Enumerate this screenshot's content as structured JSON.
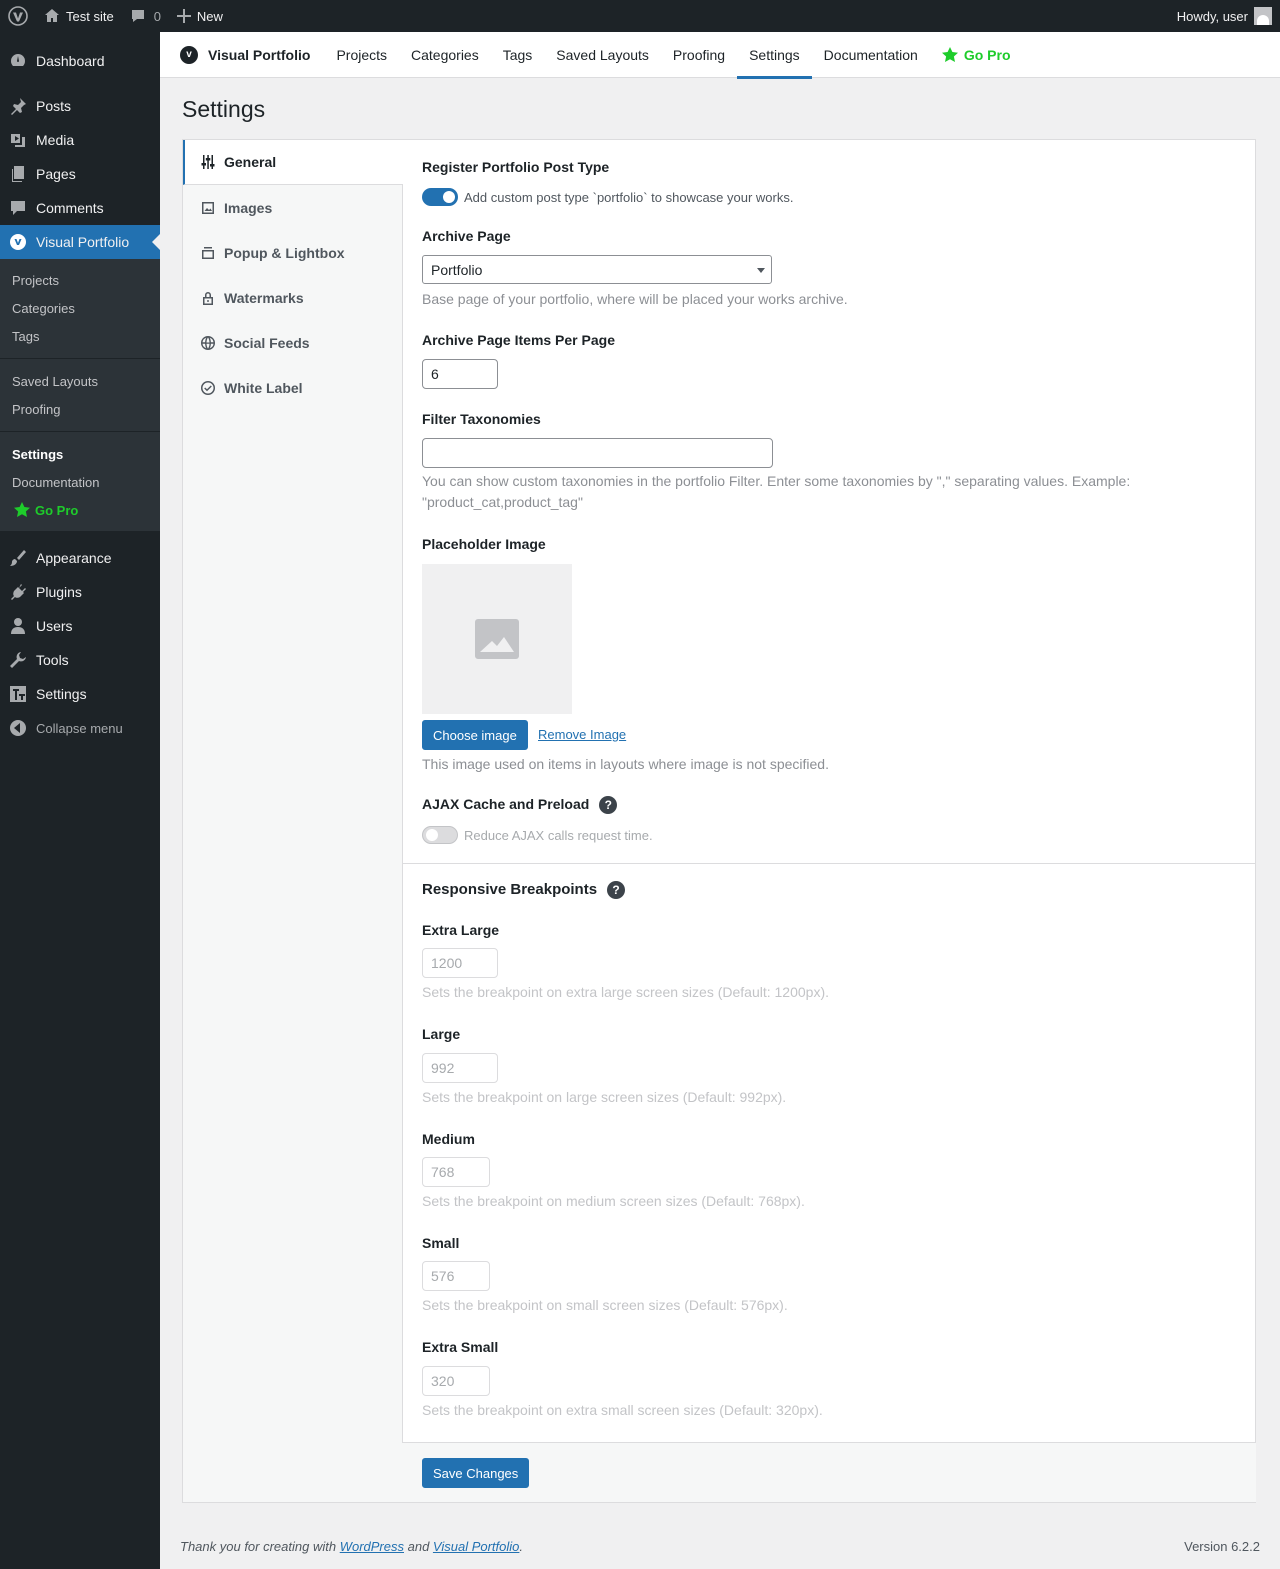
{
  "adminbar": {
    "site_name": "Test site",
    "comments_count": "0",
    "new_label": "New",
    "howdy": "Howdy, user"
  },
  "sidebar": {
    "items": [
      {
        "label": "Dashboard",
        "icon": "dashboard-icon"
      },
      {
        "label": "Posts",
        "icon": "pin-icon"
      },
      {
        "label": "Media",
        "icon": "media-icon"
      },
      {
        "label": "Pages",
        "icon": "pages-icon"
      },
      {
        "label": "Comments",
        "icon": "comment-icon"
      },
      {
        "label": "Visual Portfolio",
        "icon": "visual-portfolio-icon"
      }
    ],
    "submenu": [
      "Projects",
      "Categories",
      "Tags",
      "Saved Layouts",
      "Proofing",
      "Settings",
      "Documentation",
      "Go Pro"
    ],
    "items_after": [
      {
        "label": "Appearance",
        "icon": "brush-icon"
      },
      {
        "label": "Plugins",
        "icon": "plugin-icon"
      },
      {
        "label": "Users",
        "icon": "users-icon"
      },
      {
        "label": "Tools",
        "icon": "wrench-icon"
      },
      {
        "label": "Settings",
        "icon": "settings-icon"
      }
    ],
    "collapse": "Collapse menu"
  },
  "topnav": {
    "brand": "Visual Portfolio",
    "logo_letter": "v",
    "tabs": [
      "Projects",
      "Categories",
      "Tags",
      "Saved Layouts",
      "Proofing",
      "Settings",
      "Documentation"
    ],
    "go_pro": "Go Pro",
    "active": "Settings"
  },
  "page": {
    "title": "Settings"
  },
  "vtabs": [
    "General",
    "Images",
    "Popup & Lightbox",
    "Watermarks",
    "Social Feeds",
    "White Label"
  ],
  "general": {
    "register_label": "Register Portfolio Post Type",
    "register_desc": "Add custom post type `portfolio` to showcase your works.",
    "archive_label": "Archive Page",
    "archive_value": "Portfolio",
    "archive_desc": "Base page of your portfolio, where will be placed your works archive.",
    "items_label": "Archive Page Items Per Page",
    "items_value": "6",
    "filter_label": "Filter Taxonomies",
    "filter_value": "",
    "filter_desc_1": "You can show custom taxonomies in the portfolio Filter. Enter some taxonomies by \",\" separating values. Example:",
    "filter_desc_2": "\"product_cat,product_tag\"",
    "placeholder_label": "Placeholder Image",
    "choose_image": "Choose image",
    "remove_image": "Remove Image",
    "placeholder_desc": "This image used on items in layouts where image is not specified.",
    "ajax_label": "AJAX Cache and Preload",
    "ajax_desc": "Reduce AJAX calls request time.",
    "help_glyph": "?"
  },
  "breakpoints": {
    "title": "Responsive Breakpoints",
    "items": [
      {
        "label": "Extra Large",
        "value": "1200",
        "desc": "Sets the breakpoint on extra large screen sizes (Default: 1200px)."
      },
      {
        "label": "Large",
        "value": "992",
        "desc": "Sets the breakpoint on large screen sizes (Default: 992px)."
      },
      {
        "label": "Medium",
        "value": "768",
        "desc": "Sets the breakpoint on medium screen sizes (Default: 768px)."
      },
      {
        "label": "Small",
        "value": "576",
        "desc": "Sets the breakpoint on small screen sizes (Default: 576px)."
      },
      {
        "label": "Extra Small",
        "value": "320",
        "desc": "Sets the breakpoint on extra small screen sizes (Default: 320px)."
      }
    ]
  },
  "save_label": "Save Changes",
  "footer": {
    "thanks_prefix": "Thank you for creating with ",
    "wordpress": "WordPress",
    "and": " and ",
    "vp": "Visual Portfolio",
    "period": ".",
    "version": "Version 6.2.2"
  },
  "colors": {
    "accent": "#2271b1",
    "admin_bg": "#1d2327",
    "pro_green": "#1ecc2b"
  }
}
